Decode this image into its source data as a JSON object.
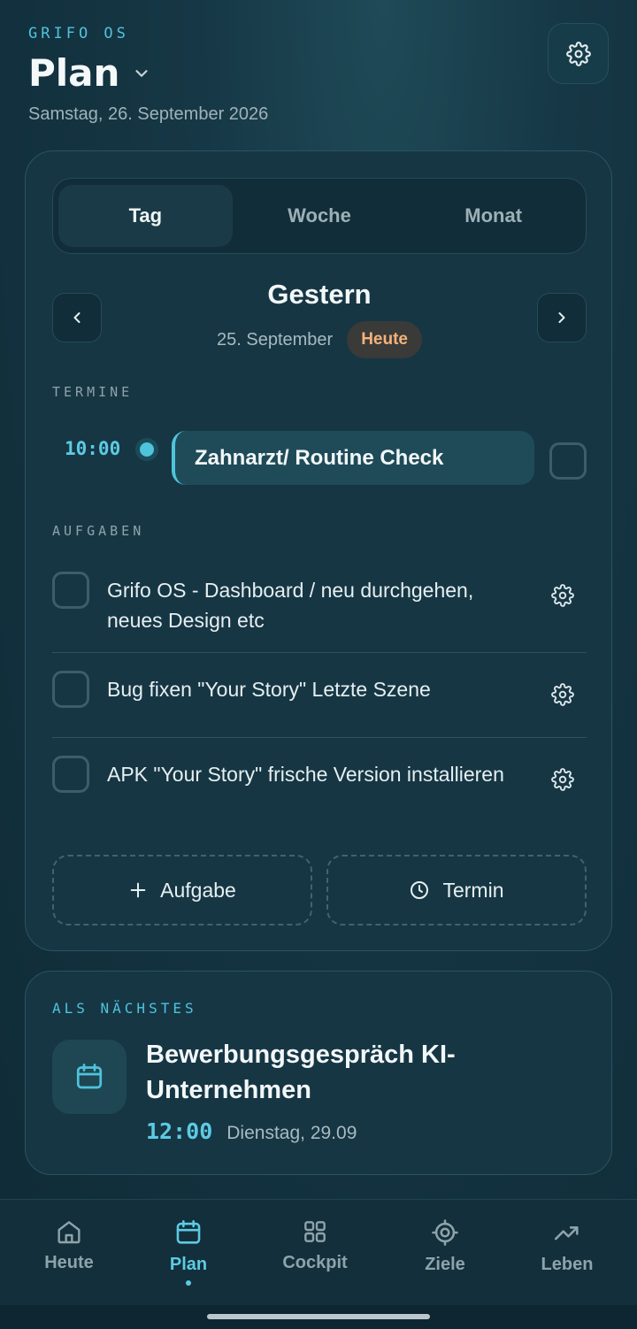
{
  "header": {
    "brand": "GRIFO OS",
    "title": "Plan",
    "date": "Samstag, 26. September 2026"
  },
  "view_tabs": [
    {
      "label": "Tag",
      "active": true
    },
    {
      "label": "Woche",
      "active": false
    },
    {
      "label": "Monat",
      "active": false
    }
  ],
  "day": {
    "title": "Gestern",
    "date": "25. September",
    "today_badge": "Heute"
  },
  "appointments": {
    "label": "TERMINE",
    "items": [
      {
        "time": "10:00",
        "title": "Zahnarzt/ Routine Check"
      }
    ]
  },
  "tasks": {
    "label": "AUFGABEN",
    "items": [
      {
        "text": "Grifo OS - Dashboard / neu durchgehen, neues Design etc"
      },
      {
        "text": "Bug fixen \"Your Story\" Letzte Szene"
      },
      {
        "text": "APK \"Your Story\" frische Version installieren"
      }
    ]
  },
  "actions": {
    "add_task": "Aufgabe",
    "add_appointment": "Termin"
  },
  "next": {
    "label": "ALS NÄCHSTES",
    "title": "Bewerbungsgespräch KI-Unternehmen",
    "time": "12:00",
    "date": "Dienstag, 29.09"
  },
  "bottom_nav": [
    {
      "label": "Heute",
      "icon": "home-icon",
      "active": false
    },
    {
      "label": "Plan",
      "icon": "calendar-icon",
      "active": true
    },
    {
      "label": "Cockpit",
      "icon": "grid-icon",
      "active": false
    },
    {
      "label": "Ziele",
      "icon": "target-icon",
      "active": false
    },
    {
      "label": "Leben",
      "icon": "trend-icon",
      "active": false
    }
  ],
  "colors": {
    "accent": "#4fc3dc",
    "background": "#12303d",
    "card": "#163644",
    "badge_text": "#f3b27a"
  }
}
